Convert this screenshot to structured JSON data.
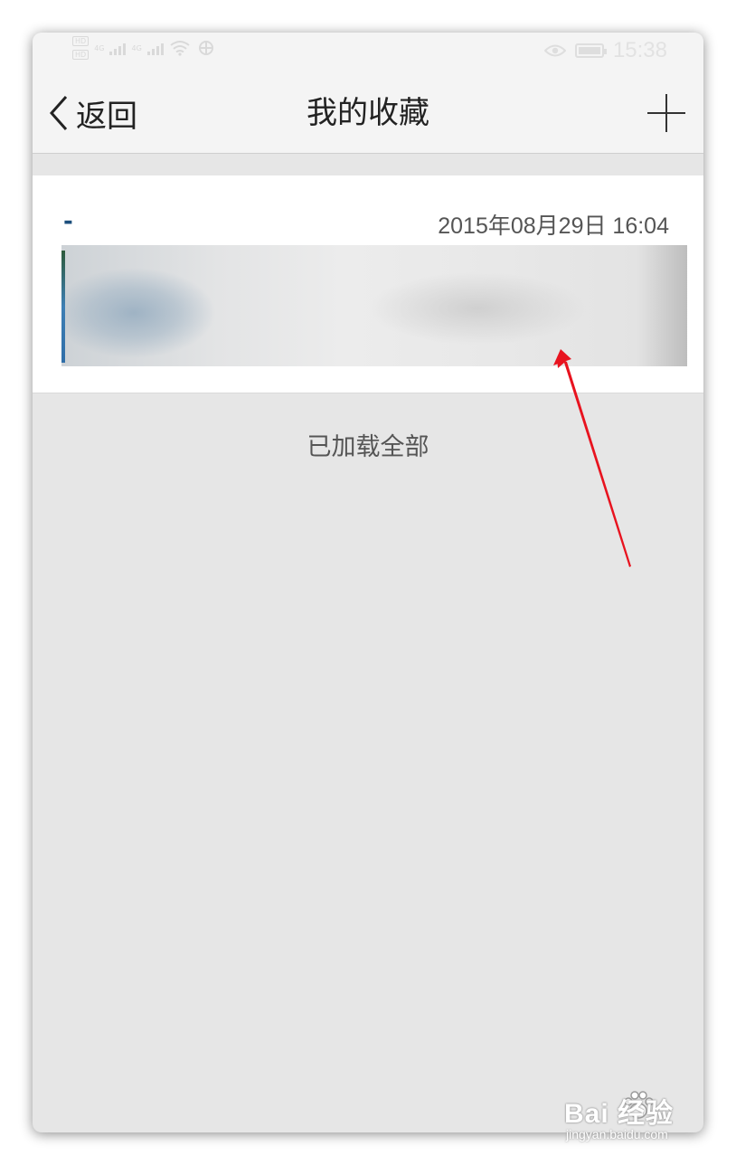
{
  "status_bar": {
    "time": "15:38",
    "network_badges": [
      "HD",
      "HD"
    ],
    "signal_labels": [
      "4G",
      "4G"
    ],
    "icons": [
      "signal-icon",
      "signal-icon",
      "wifi-icon",
      "usb-icon",
      "eye-icon",
      "battery-icon"
    ]
  },
  "nav": {
    "back_label": "返回",
    "title": "我的收藏",
    "add_icon": "plus-icon"
  },
  "favorites": [
    {
      "title": "-",
      "date": "2015年08月29日 16:04",
      "thumbnail": "blurred-image"
    }
  ],
  "footer": {
    "loaded_all": "已加载全部"
  },
  "annotation": {
    "arrow_color": "#e8131f"
  },
  "watermark": {
    "brand": "Bai 经验",
    "sub": "jingyan.baidu.com"
  },
  "colors": {
    "page_bg": "#e6e6e6",
    "bar_bg": "#f4f4f4",
    "title_accent": "#1c4f7c"
  }
}
